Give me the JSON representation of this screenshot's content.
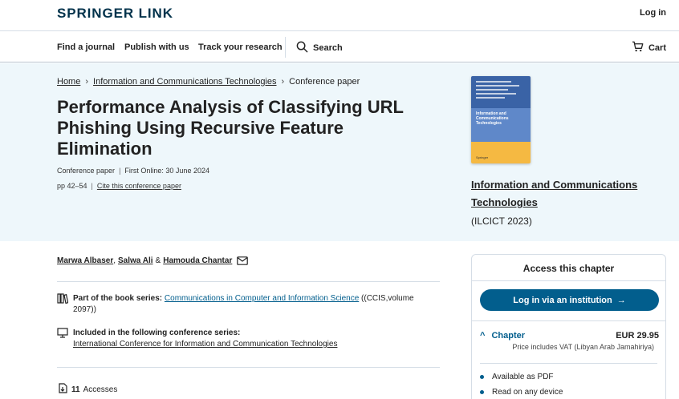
{
  "header": {
    "logo": "SPRINGER LINK",
    "login": "Log in"
  },
  "nav": {
    "find_journal": "Find a journal",
    "publish": "Publish with us",
    "track": "Track your research",
    "search": "Search",
    "cart": "Cart"
  },
  "breadcrumb": {
    "home": "Home",
    "section": "Information and Communications Technologies",
    "current": "Conference paper"
  },
  "article": {
    "title": "Performance Analysis of Classifying URL Phishing Using Recursive Feature Elimination",
    "type": "Conference paper",
    "first_online": "First Online: 30 June 2024",
    "pages": "pp 42–54",
    "cite": "Cite this conference paper"
  },
  "book": {
    "cover_title": "Information and Communications Technologies",
    "cover_publisher": "Springer",
    "title": "Information and Communications Technologies",
    "subtitle": "(ILCICT 2023)"
  },
  "authors": {
    "a1": "Marwa Albaser",
    "comma": ",",
    "a2": "Salwa Ali",
    "amp": "&",
    "a3": "Hamouda Chantar"
  },
  "series": {
    "label": "Part of the book series:",
    "link": "Communications in Computer and Information Science",
    "suffix": "((CCIS,volume 2097))"
  },
  "conference": {
    "label": "Included in the following conference series:",
    "link": "International Conference for Information and Communication Technologies"
  },
  "stats": {
    "accesses_count": "11",
    "accesses_label": "Accesses"
  },
  "access": {
    "heading": "Access this chapter",
    "login_button": "Log in via an institution",
    "chapter_label": "Chapter",
    "price": "EUR 29.95",
    "vat": "Price includes VAT (Libyan Arab Jamahiriya)",
    "features": [
      "Available as PDF",
      "Read on any device"
    ]
  },
  "colors": {
    "brand": "#01324b",
    "accent": "#025e8d",
    "hero_bg": "#eef7fb"
  }
}
